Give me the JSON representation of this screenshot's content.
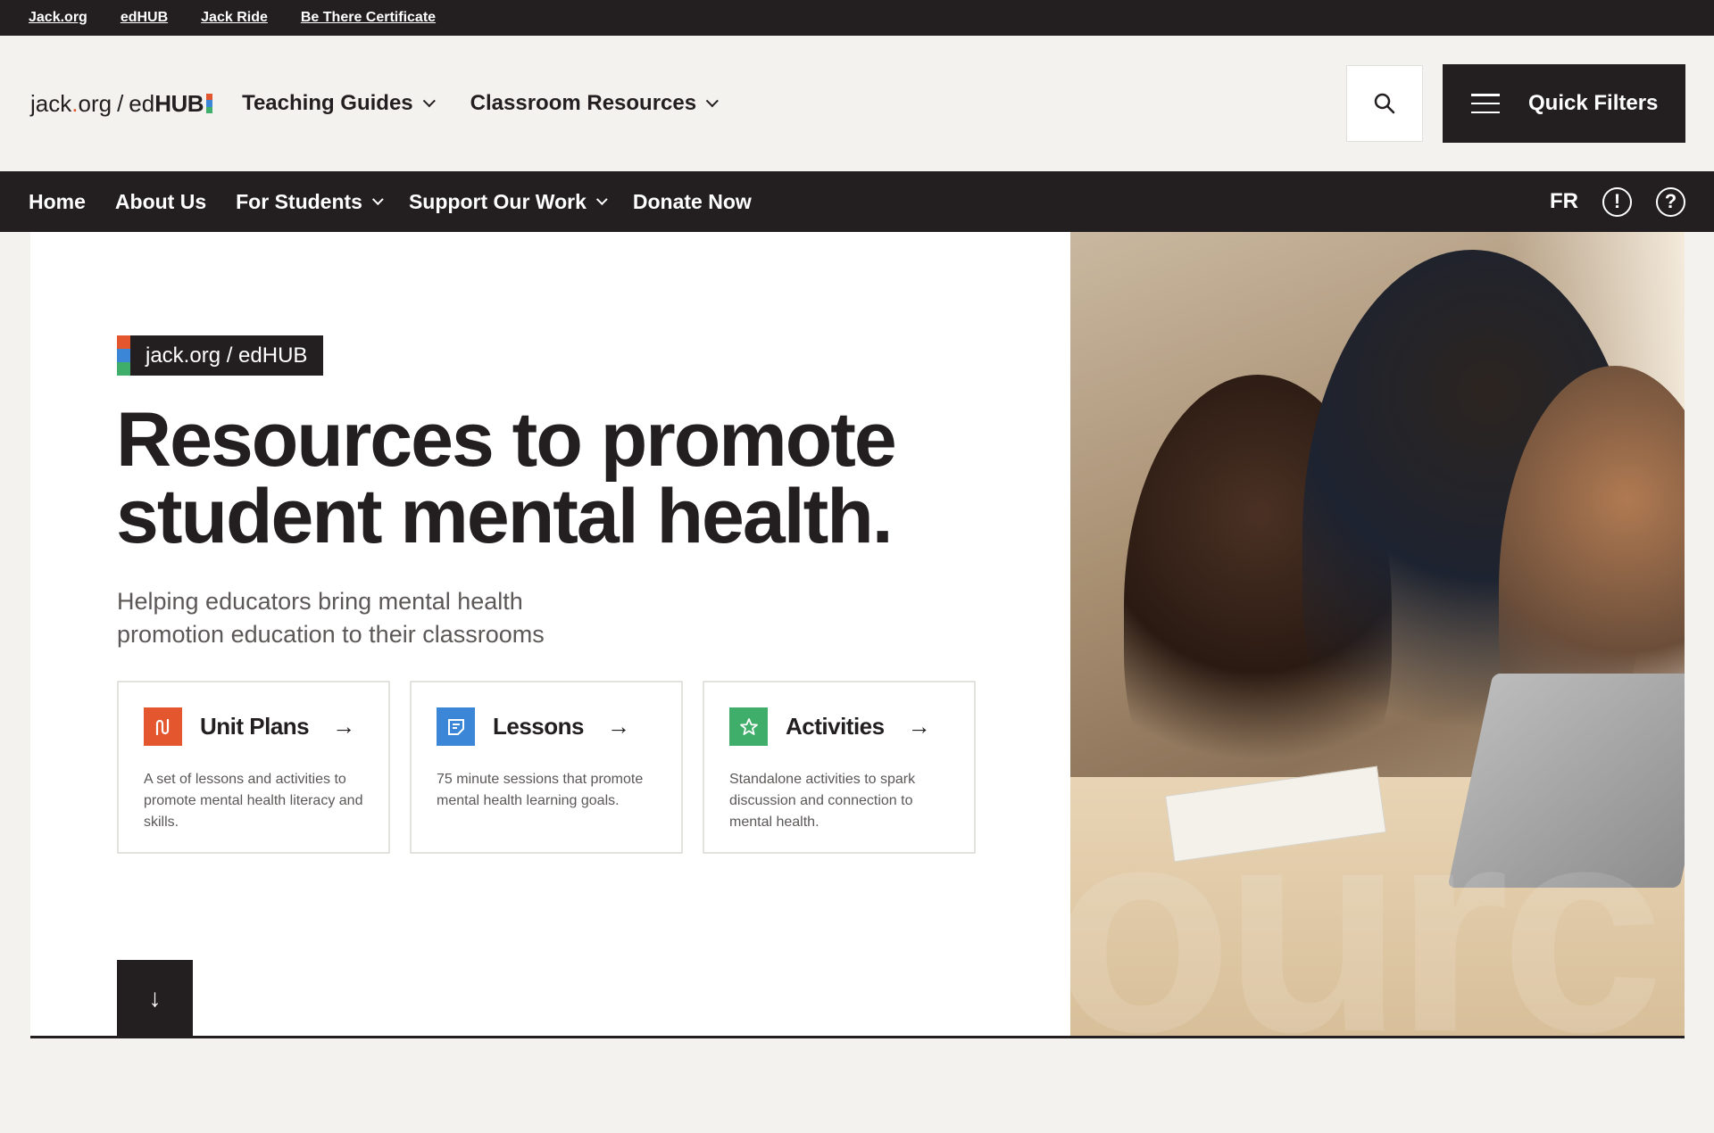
{
  "utility_links": [
    "Jack.org",
    "edHUB",
    "Jack Ride",
    "Be There Certificate"
  ],
  "logo": {
    "part1": "jack",
    "dot": ".",
    "part2": "org",
    "slash": "/",
    "part3": "ed",
    "part4": "HUB"
  },
  "header_nav": [
    {
      "label": "Teaching Guides"
    },
    {
      "label": "Classroom Resources"
    }
  ],
  "quick_filters_label": "Quick Filters",
  "secondary_nav": {
    "home": "Home",
    "about": "About Us",
    "students": "For Students",
    "support": "Support Our Work",
    "donate": "Donate Now",
    "lang": "FR",
    "alert_glyph": "!",
    "help_glyph": "?"
  },
  "hero": {
    "badge": "jack.org / edHUB",
    "headline_line1": "Resources to promote",
    "headline_line2": "student mental health.",
    "subhead_line1": "Helping educators bring mental health",
    "subhead_line2": "promotion education to their classrooms",
    "watermark": "ourc",
    "cards": [
      {
        "title": "Unit Plans",
        "desc": "A set of lessons and activities to promote mental health literacy and skills.",
        "color": "#e4572e",
        "icon": "unit-plans-icon"
      },
      {
        "title": "Lessons",
        "desc": "75 minute sessions that promote mental health learning goals.",
        "color": "#3b86d6",
        "icon": "lessons-icon"
      },
      {
        "title": "Activities",
        "desc": "Standalone activities to spark discussion and connection to mental health.",
        "color": "#3fae6a",
        "icon": "activities-icon"
      }
    ],
    "scroll_glyph": "↓",
    "arrow_glyph": "→"
  },
  "colors": {
    "dark": "#231f20",
    "orange": "#e4572e",
    "blue": "#3b86d6",
    "green": "#3fae6a",
    "page_bg": "#f3f2ef"
  }
}
